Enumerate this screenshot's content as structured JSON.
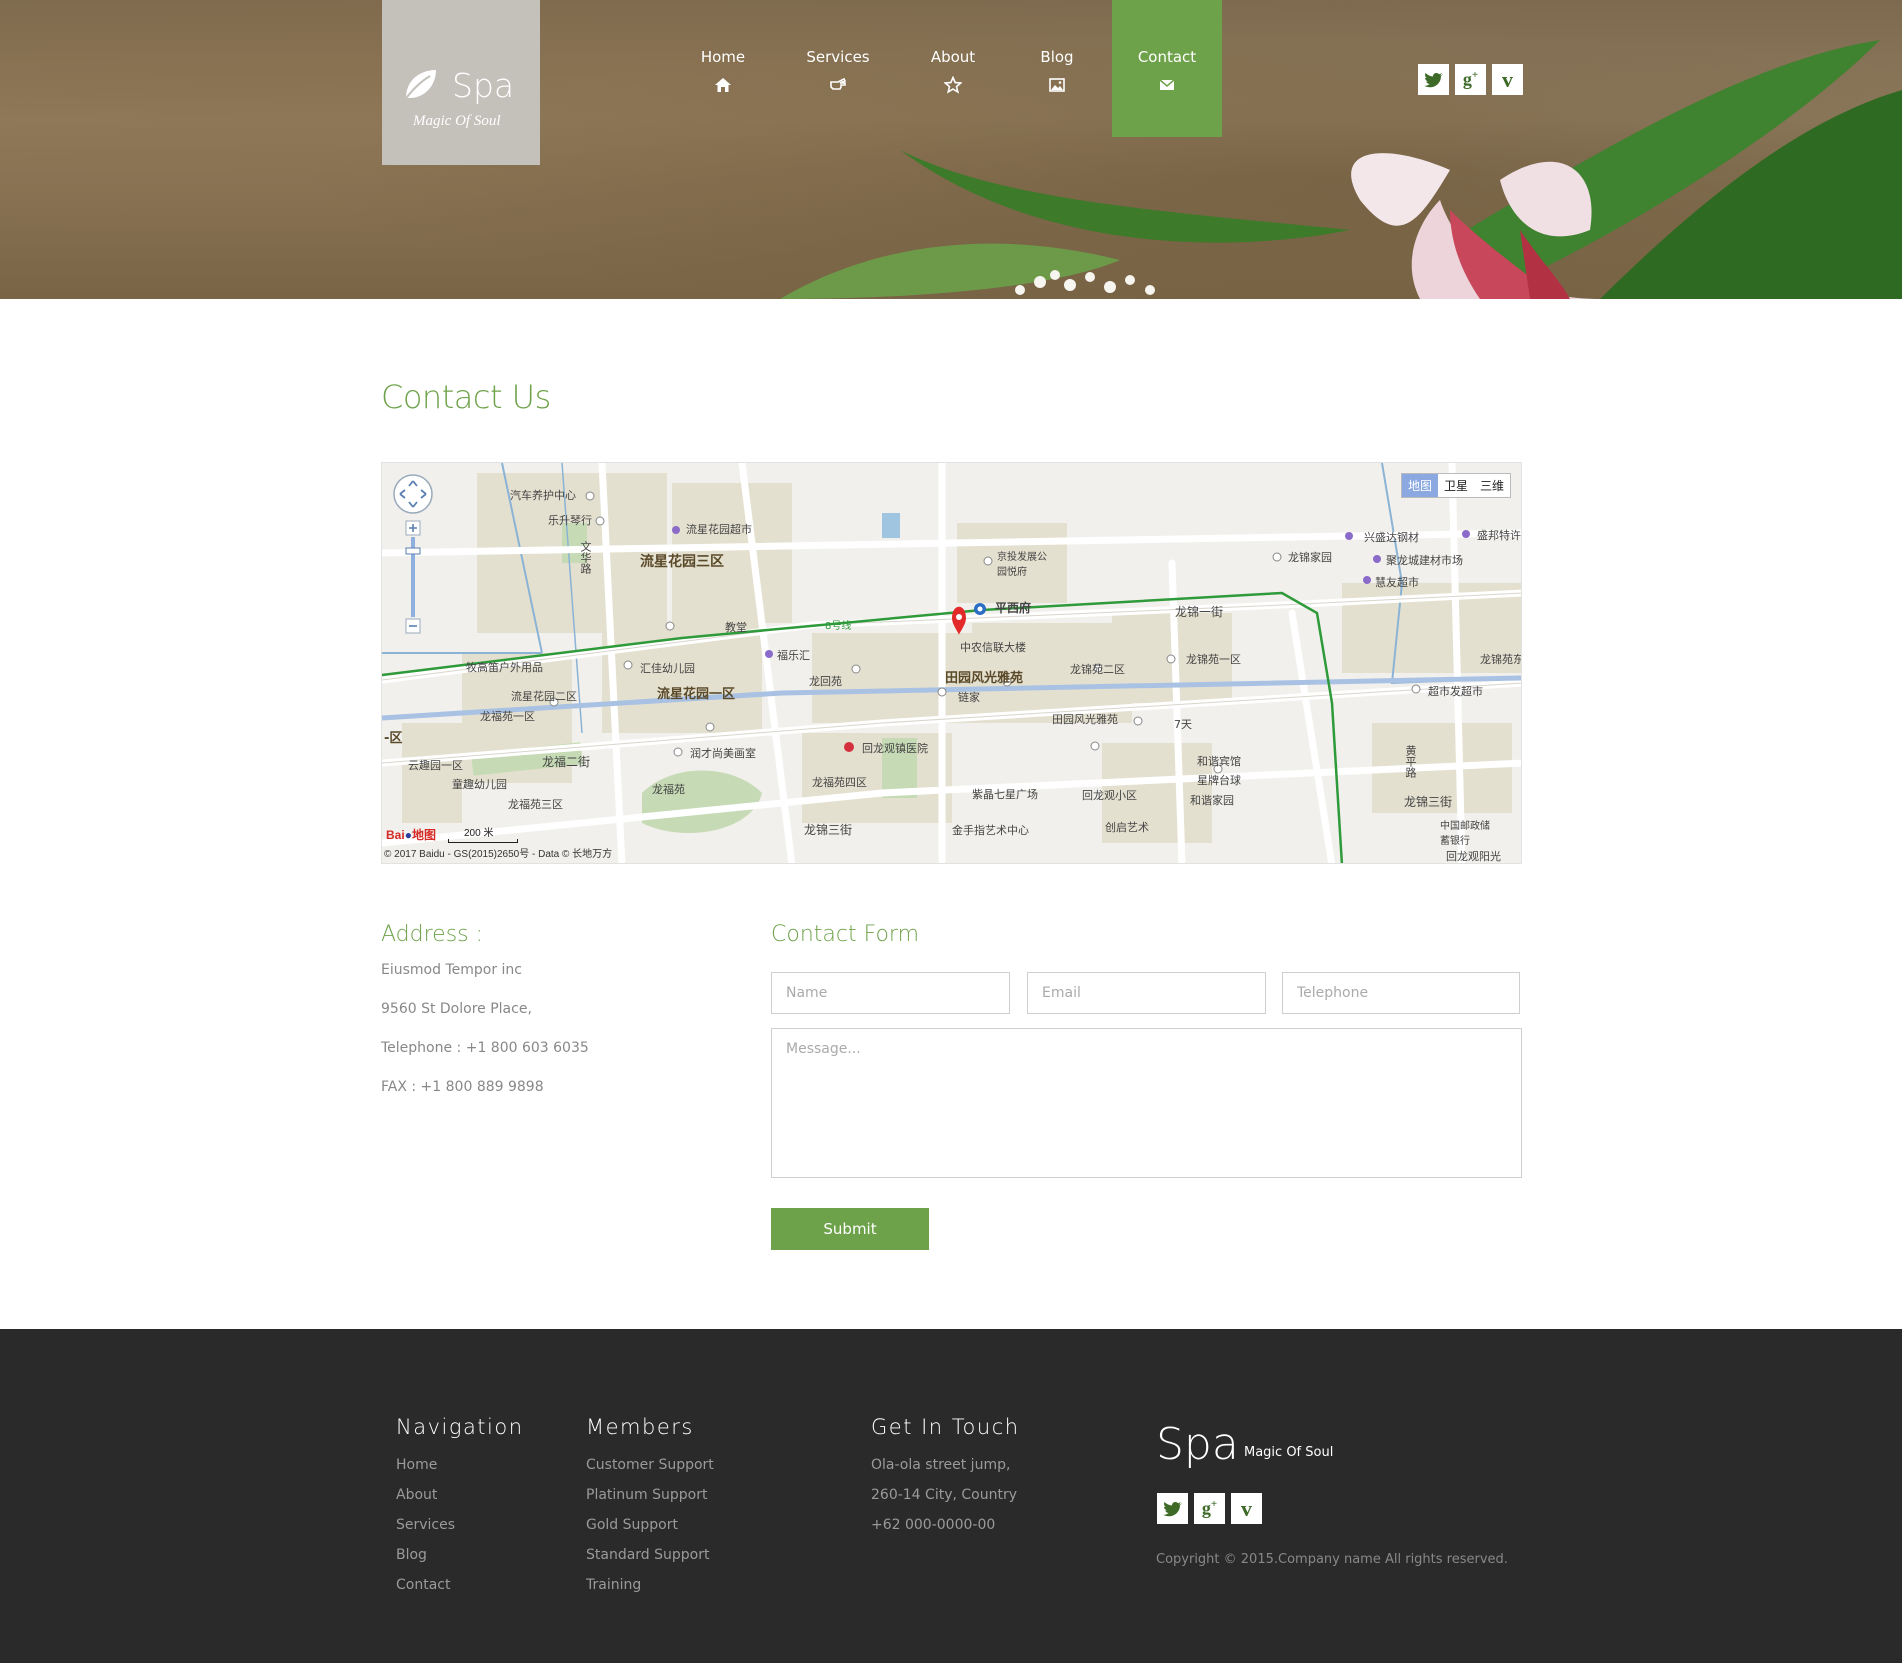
{
  "header": {
    "logo_name": "Spa",
    "logo_tagline": "Magic Of Soul",
    "nav": [
      {
        "label": "Home",
        "icon": "home-icon"
      },
      {
        "label": "Services",
        "icon": "hand-pointer-icon"
      },
      {
        "label": "About",
        "icon": "star-icon"
      },
      {
        "label": "Blog",
        "icon": "image-icon"
      },
      {
        "label": "Contact",
        "icon": "envelope-icon"
      }
    ],
    "active_nav": "Contact",
    "social": [
      "twitter-icon",
      "google-plus-icon",
      "vimeo-icon"
    ],
    "accent_color": "#6ea24a"
  },
  "main": {
    "title": "Contact Us",
    "map": {
      "type_buttons": [
        "地图",
        "卫星",
        "三维"
      ],
      "active_type": "地图",
      "labels": {
        "l1": "汽车养护中心",
        "l2": "乐升琴行",
        "l3": "流星花园超市",
        "l4": "流星花园三区",
        "l5": "文华路",
        "l6": "京投发展公园悦府",
        "l7": "平西府",
        "l8": "8号线",
        "l9": "兴盛达钢材",
        "l10": "盛邦特许",
        "l11": "龙锦家园",
        "l12": "聚龙城建材市场",
        "l13": "慧友超市",
        "l14": "龙锦一街",
        "l15": "教堂",
        "l16": "中农信联大楼",
        "l17": "田园风光雅苑",
        "l18": "龙锦苑二区",
        "l19": "龙锦苑一区",
        "l20": "牧高笛户外用品",
        "l21": "汇佳幼儿园",
        "l22": "福乐汇",
        "l23": "流星花园一区",
        "l24": "龙回苑",
        "l25": "链家",
        "l26": "流星花园二区",
        "l27": "龙福苑一区",
        "l28": "田园风光雅苑",
        "l29": "7天",
        "l30": "超市发超市",
        "l31": "回龙观镇医院",
        "l32": "润才尚美画室",
        "l33": "龙福二街",
        "l34": "云趣园一区",
        "l35": "和谐宾馆",
        "l36": "星牌台球",
        "l37": "童趣幼儿园",
        "l38": "龙福苑",
        "l39": "龙福苑四区",
        "l40": "紫晶七星广场",
        "l41": "回龙观小区",
        "l42": "和谐家园",
        "l43": "龙锦三街",
        "l44": "龙福苑三区",
        "l45": "金手指艺术中心",
        "l46": "创启艺术",
        "l47": "中国邮政储蓄银行",
        "l48": "回龙观阳光",
        "l49": "黄平路",
        "l50": "龙锦苑东",
        "l51": "龙锦三街",
        "l52": "-区"
      },
      "scale": "200 米",
      "copyright": "© 2017 Baidu - GS(2015)2650号 - Data © 长地万方"
    },
    "address": {
      "title": "Address :",
      "lines": [
        "Eiusmod Tempor inc",
        "9560 St Dolore Place,",
        "Telephone : +1 800 603 6035",
        "FAX : +1 800 889 9898"
      ]
    },
    "form": {
      "title": "Contact Form",
      "name_placeholder": "Name",
      "email_placeholder": "Email",
      "telephone_placeholder": "Telephone",
      "message_placeholder": "Message...",
      "submit_label": "Submit"
    }
  },
  "footer": {
    "navigation": {
      "title": "Navigation",
      "links": [
        "Home",
        "About",
        "Services",
        "Blog",
        "Contact"
      ]
    },
    "members": {
      "title": "Members",
      "links": [
        "Customer Support",
        "Platinum Support",
        "Gold Support",
        "Standard Support",
        "Training"
      ]
    },
    "contact": {
      "title": "Get In Touch",
      "lines": [
        "Ola-ola street jump,",
        "260-14 City, Country",
        "+62 000-0000-00"
      ]
    },
    "logo_name": "Spa",
    "logo_tagline": "Magic Of Soul",
    "copyright": "Copyright © 2015.Company name All rights reserved.",
    "background_color": "#2a2a2a"
  }
}
